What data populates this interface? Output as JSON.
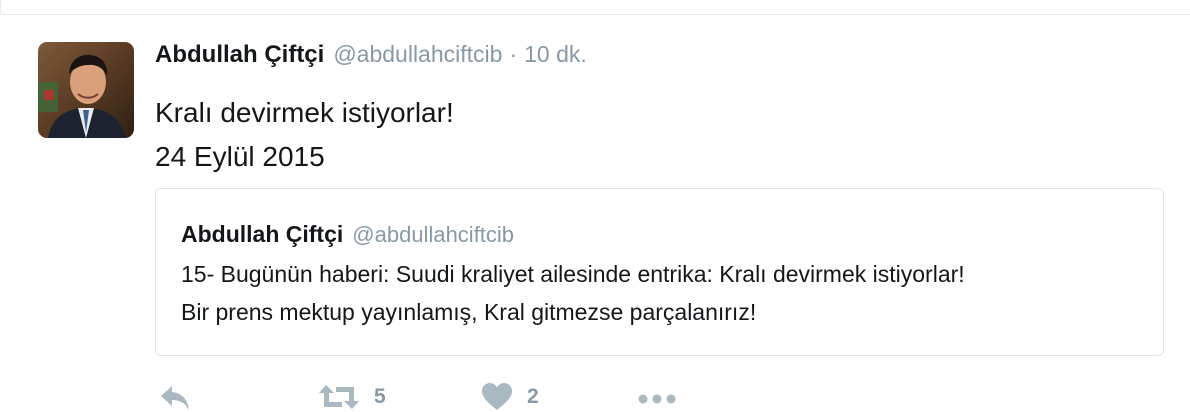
{
  "tweet": {
    "author": {
      "fullname": "Abdullah Çiftçi",
      "handle": "@abdullahciftcib"
    },
    "separator": "·",
    "time": "10 dk.",
    "text_lines": [
      "Kralı devirmek istiyorlar!",
      "24 Eylül 2015"
    ],
    "quoted": {
      "fullname": "Abdullah Çiftçi",
      "handle": "@abdullahciftcib",
      "text_lines": [
        "15- Bugünün haberi: Suudi kraliyet ailesinde entrika: Kralı devirmek istiyorlar!",
        "Bir prens mektup yayınlamış, Kral gitmezse parçalanırız!"
      ]
    },
    "actions": {
      "reply": {
        "icon": "reply-icon"
      },
      "retweet": {
        "icon": "retweet-icon",
        "count": "5"
      },
      "like": {
        "icon": "heart-icon",
        "count": "2"
      },
      "more": {
        "icon": "more-icon"
      }
    }
  },
  "colors": {
    "text": "#14171a",
    "secondary": "#8899a6",
    "border": "#e1e8ed",
    "icon": "#aab8c2"
  }
}
